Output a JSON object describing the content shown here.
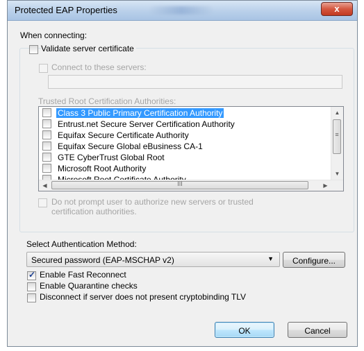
{
  "window": {
    "title": "Protected EAP Properties",
    "close_glyph": "x"
  },
  "when_connecting": {
    "label": "When connecting:"
  },
  "validate_cert": {
    "label": "Validate server certificate",
    "checked": false
  },
  "connect_servers": {
    "label": "Connect to these servers:",
    "checked": false,
    "value": ""
  },
  "trusted_ca": {
    "label": "Trusted Root Certification Authorities:",
    "items": [
      {
        "label": "Class 3 Public Primary Certification Authority",
        "checked": false,
        "selected": true
      },
      {
        "label": "Entrust.net Secure Server Certification Authority",
        "checked": false
      },
      {
        "label": "Equifax Secure Certificate Authority",
        "checked": false
      },
      {
        "label": "Equifax Secure Global eBusiness CA-1",
        "checked": false
      },
      {
        "label": "GTE CyberTrust Global Root",
        "checked": false
      },
      {
        "label": "Microsoft Root Authority",
        "checked": false
      },
      {
        "label": "Microsoft Root Certificate Authority",
        "checked": false
      }
    ],
    "scroll_grip": "III"
  },
  "do_not_prompt": {
    "label_line1": "Do not prompt user to authorize new servers or trusted",
    "label_line2": "certification authorities.",
    "checked": false
  },
  "auth_method": {
    "label": "Select Authentication Method:",
    "selected": "Secured password (EAP-MSCHAP v2)",
    "configure_label": "Configure..."
  },
  "options": [
    {
      "label": "Enable Fast Reconnect",
      "checked": true
    },
    {
      "label": "Enable Quarantine checks",
      "checked": false
    },
    {
      "label": "Disconnect if server does not present cryptobinding TLV",
      "checked": false
    }
  ],
  "buttons": {
    "ok": "OK",
    "cancel": "Cancel"
  },
  "icons": {
    "close": "close-icon",
    "dropdown": "chevron-down-icon",
    "scroll_up": "arrow-up-icon",
    "scroll_down": "arrow-down-icon",
    "scroll_left": "arrow-left-icon",
    "scroll_right": "arrow-right-icon"
  }
}
